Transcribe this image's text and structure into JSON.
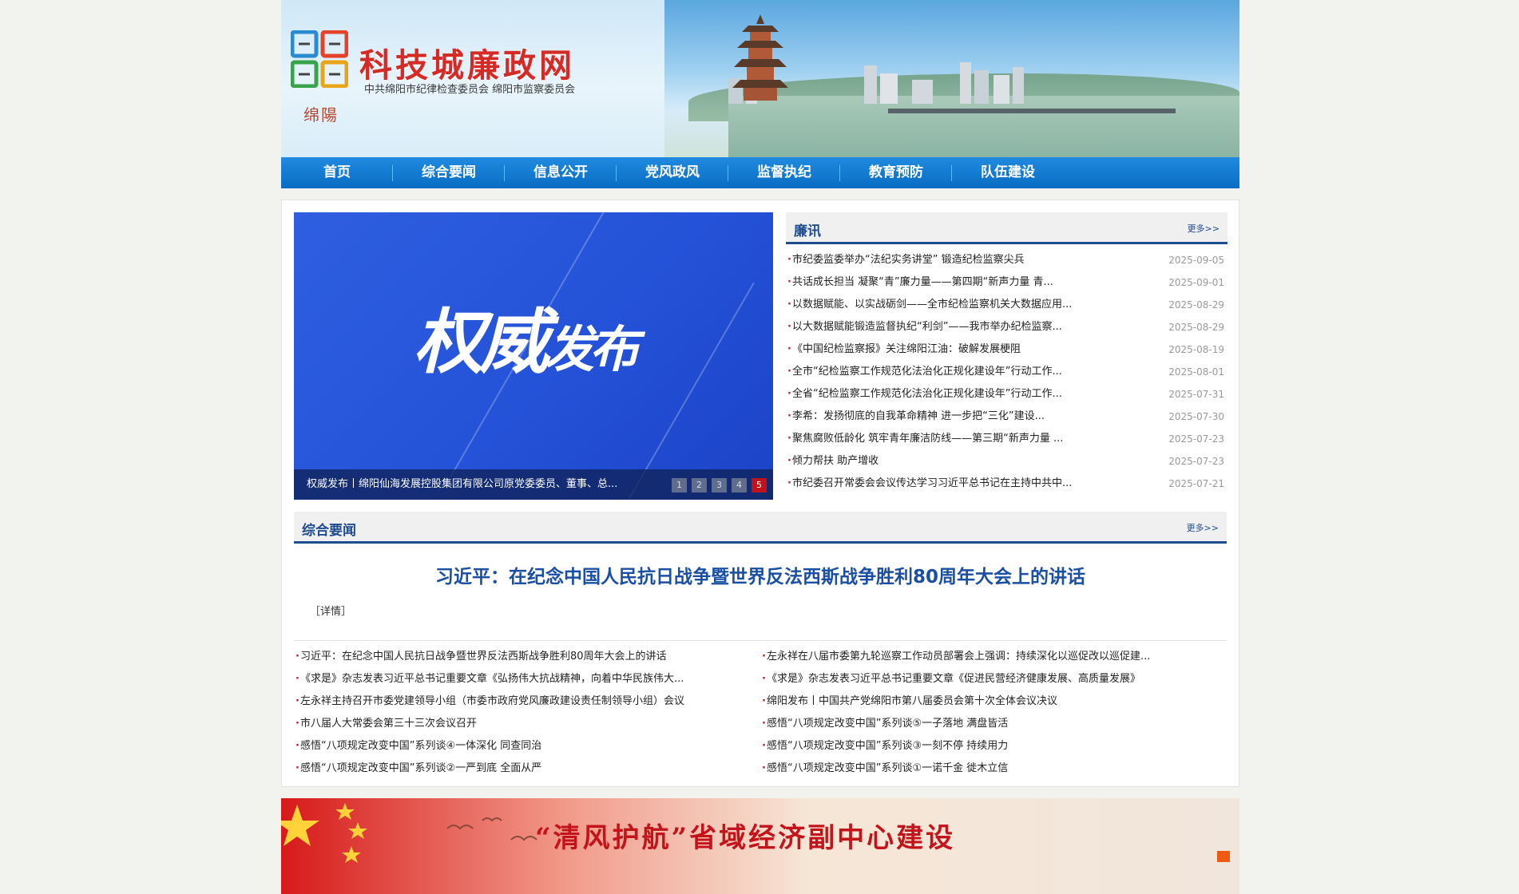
{
  "header": {
    "site_title": "科技城廉政网",
    "site_subtitle": "中共绵阳市纪律检查委员会 绵阳市监察委员会",
    "logo_city": "绵陽"
  },
  "nav": {
    "items": [
      "首页",
      "综合要闻",
      "信息公开",
      "党风政风",
      "监督执纪",
      "教育预防",
      "队伍建设"
    ]
  },
  "slider": {
    "image_text_a": "权威",
    "image_text_b": "发布",
    "caption": "权威发布丨绵阳仙海发展控股集团有限公司原党委委员、董事、总...",
    "pages": [
      "1",
      "2",
      "3",
      "4",
      "5"
    ],
    "active_page": 5
  },
  "lianxun": {
    "title": "廉讯",
    "more": "更多>>",
    "items": [
      {
        "title": "市纪委监委举办“法纪实务讲堂” 锻造纪检监察尖兵",
        "date": "2025-09-05"
      },
      {
        "title": "共话成长担当 凝聚“青”廉力量——第四期“新声力量 青...",
        "date": "2025-09-01"
      },
      {
        "title": "以数据赋能、以实战砺剑——全市纪检监察机关大数据应用...",
        "date": "2025-08-29"
      },
      {
        "title": "以大数据赋能锻造监督执纪“利剑”——我市举办纪检监察...",
        "date": "2025-08-29"
      },
      {
        "title": "《中国纪检监察报》关注绵阳江油：破解发展梗阻",
        "date": "2025-08-19"
      },
      {
        "title": "全市“纪检监察工作规范化法治化正规化建设年”行动工作...",
        "date": "2025-08-01"
      },
      {
        "title": "全省“纪检监察工作规范化法治化正规化建设年”行动工作...",
        "date": "2025-07-31"
      },
      {
        "title": "李希：发扬彻底的自我革命精神 进一步把“三化”建设...",
        "date": "2025-07-30"
      },
      {
        "title": "聚焦腐败低龄化 筑牢青年廉洁防线——第三期“新声力量 ...",
        "date": "2025-07-23"
      },
      {
        "title": "倾力帮扶 助产增收",
        "date": "2025-07-23"
      },
      {
        "title": "市纪委召开常委会会议传达学习习近平总书记在主持中共中...",
        "date": "2025-07-21"
      }
    ]
  },
  "zonghe": {
    "title": "综合要闻",
    "more": "更多>>",
    "headline": "习近平：在纪念中国人民抗日战争暨世界反法西斯战争胜利80周年大会上的讲话",
    "detail": "［详情］",
    "left_items": [
      "习近平：在纪念中国人民抗日战争暨世界反法西斯战争胜利80周年大会上的讲话",
      "《求是》杂志发表习近平总书记重要文章《弘扬伟大抗战精神，向着中华民族伟大...",
      "左永祥主持召开市委党建领导小组（市委市政府党风廉政建设责任制领导小组）会议",
      "市八届人大常委会第三十三次会议召开",
      "感悟“八项规定改变中国”系列谈④一体深化 同查同治",
      "感悟“八项规定改变中国”系列谈②一严到底 全面从严"
    ],
    "right_items": [
      "左永祥在八届市委第九轮巡察工作动员部署会上强调：持续深化以巡促改以巡促建...",
      "《求是》杂志发表习近平总书记重要文章《促进民营经济健康发展、高质量发展》",
      "绵阳发布丨中国共产党绵阳市第八届委员会第十次全体会议决议",
      "感悟“八项规定改变中国”系列谈⑤一子落地 满盘皆活",
      "感悟“八项规定改变中国”系列谈③一刻不停 持续用力",
      "感悟“八项规定改变中国”系列谈①一诺千金 徙木立信"
    ]
  },
  "bottom_banner": {
    "slogan": "“清风护航”省域经济副中心建设"
  },
  "colors": {
    "nav_blue": "#0a6cc4",
    "accent_navy": "#1e4c8f",
    "title_red": "#d52b26",
    "active_dot": "#c1121b"
  }
}
